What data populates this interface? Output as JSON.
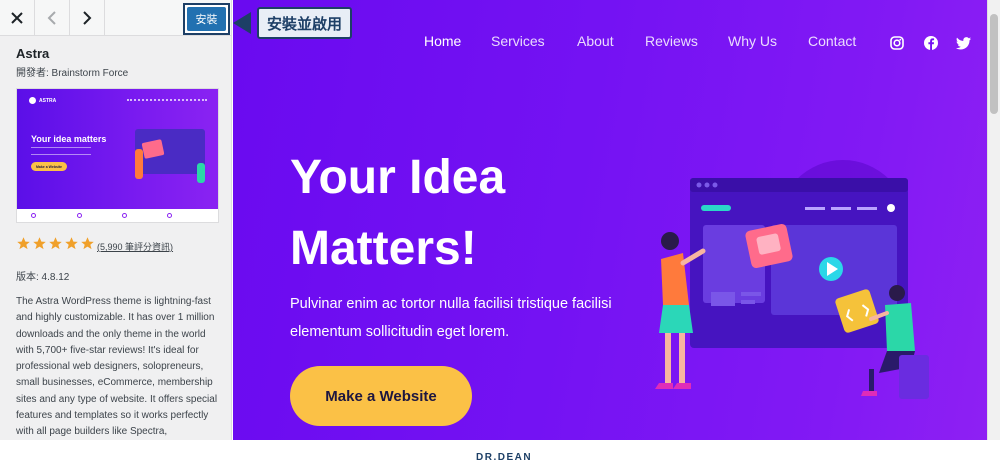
{
  "toolbar": {
    "install_label": "安裝"
  },
  "callout": {
    "text": "安裝並啟用"
  },
  "theme": {
    "name": "Astra",
    "author": "開發者: Brainstorm Force",
    "rating_link": "(5,990 筆評分資訊)",
    "rating_stars": 5,
    "version": "版本: 4.8.12",
    "description": "The Astra WordPress theme is lightning-fast and highly customizable. It has over 1 million downloads and the only theme in the world with 5,700+ five-star reviews! It's ideal for professional web designers, solopreneurs, small businesses, eCommerce, membership sites and any type of website. It offers special features and templates so it works perfectly with all page builders like Spectra,"
  },
  "thumbnail": {
    "brand": "ASTRA",
    "title": "Your idea matters",
    "button": "Make a Website"
  },
  "preview": {
    "nav": [
      "Home",
      "Services",
      "About",
      "Reviews",
      "Why Us",
      "Contact"
    ],
    "active_nav": "Home",
    "hero_title": "Your Idea Matters!",
    "hero_sub": "Pulvinar enim ac tortor nulla facilisi tristique facilisi elementum sollicitudin eget lorem.",
    "cta": "Make a Website",
    "social": [
      "instagram-icon",
      "facebook-icon",
      "twitter-icon"
    ]
  },
  "footer": {
    "logo": "DR.DEAN"
  },
  "colors": {
    "hero_gradient_start": "#6a0af0",
    "hero_gradient_end": "#8e20f3",
    "cta": "#fbc146",
    "install": "#2271b1",
    "callout_border": "#1d3f66",
    "star": "#f0a02a"
  }
}
